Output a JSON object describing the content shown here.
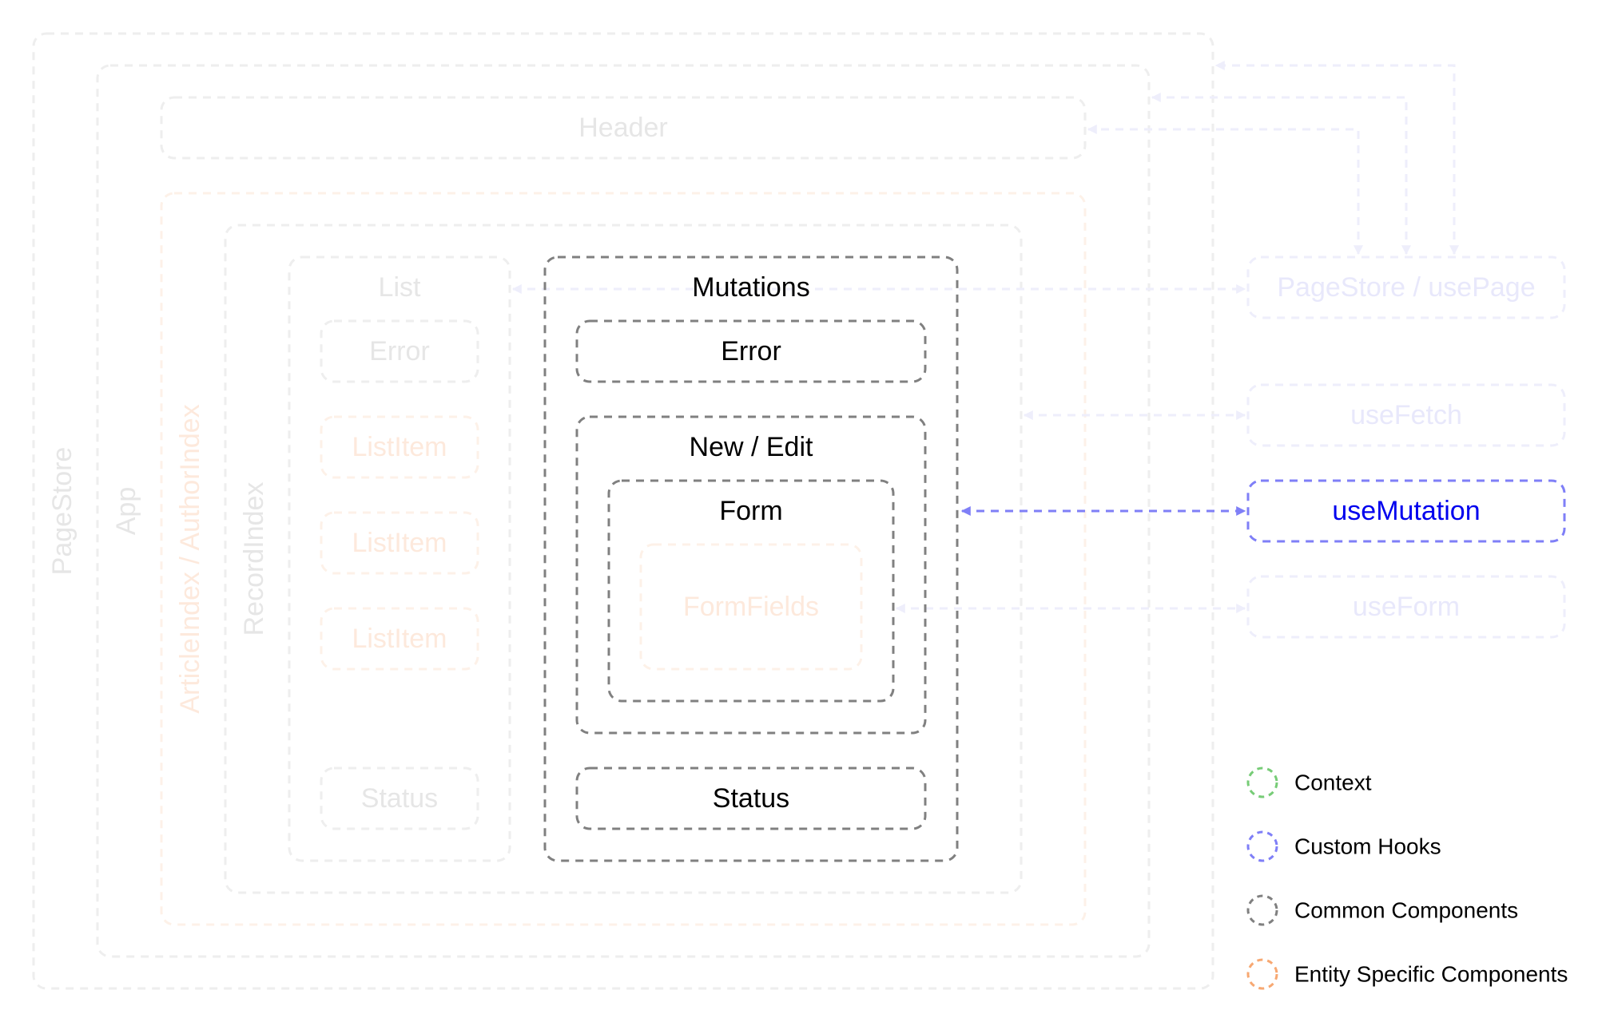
{
  "colors": {
    "context": "#77cc77",
    "custom_hooks": "#7f7ff7",
    "custom_hooks_text": "#0000ee",
    "common_components": "#808080",
    "entity_specific": "#f7a872",
    "faded_gray": "#eeeeee",
    "faded_gray_text": "#e6e6e6",
    "faded_orange": "#fdf1e8",
    "faded_orange_text": "#fde9dc",
    "faded_blue": "#eeeefb",
    "faded_blue_text": "#e8e8fb",
    "active_text": "#000000"
  },
  "components": {
    "page_store": {
      "label": "PageStore",
      "state": "faded",
      "kind": "common"
    },
    "app": {
      "label": "App",
      "state": "faded",
      "kind": "common"
    },
    "header": {
      "label": "Header",
      "state": "faded",
      "kind": "common"
    },
    "entity_index": {
      "label": "ArticleIndex / AuthorIndex",
      "state": "faded",
      "kind": "entity"
    },
    "record_index": {
      "label": "RecordIndex",
      "state": "faded",
      "kind": "common"
    },
    "list": {
      "label": "List",
      "state": "faded",
      "kind": "common",
      "error": {
        "label": "Error"
      },
      "items": [
        {
          "label": "ListItem"
        },
        {
          "label": "ListItem"
        },
        {
          "label": "ListItem"
        }
      ],
      "status": {
        "label": "Status"
      }
    },
    "mutations": {
      "label": "Mutations",
      "state": "active",
      "kind": "common",
      "error": {
        "label": "Error"
      },
      "new_edit": {
        "label": "New / Edit",
        "form": {
          "label": "Form",
          "form_fields": {
            "label": "FormFields",
            "state": "faded",
            "kind": "entity"
          }
        }
      },
      "status": {
        "label": "Status"
      }
    }
  },
  "hooks": [
    {
      "id": "use-page",
      "label": "PageStore / usePage",
      "state": "faded"
    },
    {
      "id": "use-fetch",
      "label": "useFetch",
      "state": "faded"
    },
    {
      "id": "use-mutation",
      "label": "useMutation",
      "state": "active"
    },
    {
      "id": "use-form",
      "label": "useForm",
      "state": "faded"
    }
  ],
  "connections": [
    {
      "from": "use-page",
      "to": "page-store",
      "state": "faded"
    },
    {
      "from": "use-page",
      "to": "app",
      "state": "faded"
    },
    {
      "from": "use-page",
      "to": "header",
      "state": "faded"
    },
    {
      "from": "use-page",
      "to": "list",
      "state": "faded",
      "bidirectional": true
    },
    {
      "from": "use-fetch",
      "to": "record-index",
      "state": "faded",
      "bidirectional": true
    },
    {
      "from": "use-mutation",
      "to": "mutations",
      "state": "active",
      "bidirectional": true
    },
    {
      "from": "use-form",
      "to": "form",
      "state": "faded",
      "bidirectional": true
    }
  ],
  "legend": [
    {
      "label": "Context",
      "color_key": "context"
    },
    {
      "label": "Custom Hooks",
      "color_key": "custom_hooks"
    },
    {
      "label": "Common Components",
      "color_key": "common_components"
    },
    {
      "label": "Entity Specific Components",
      "color_key": "entity_specific"
    }
  ]
}
